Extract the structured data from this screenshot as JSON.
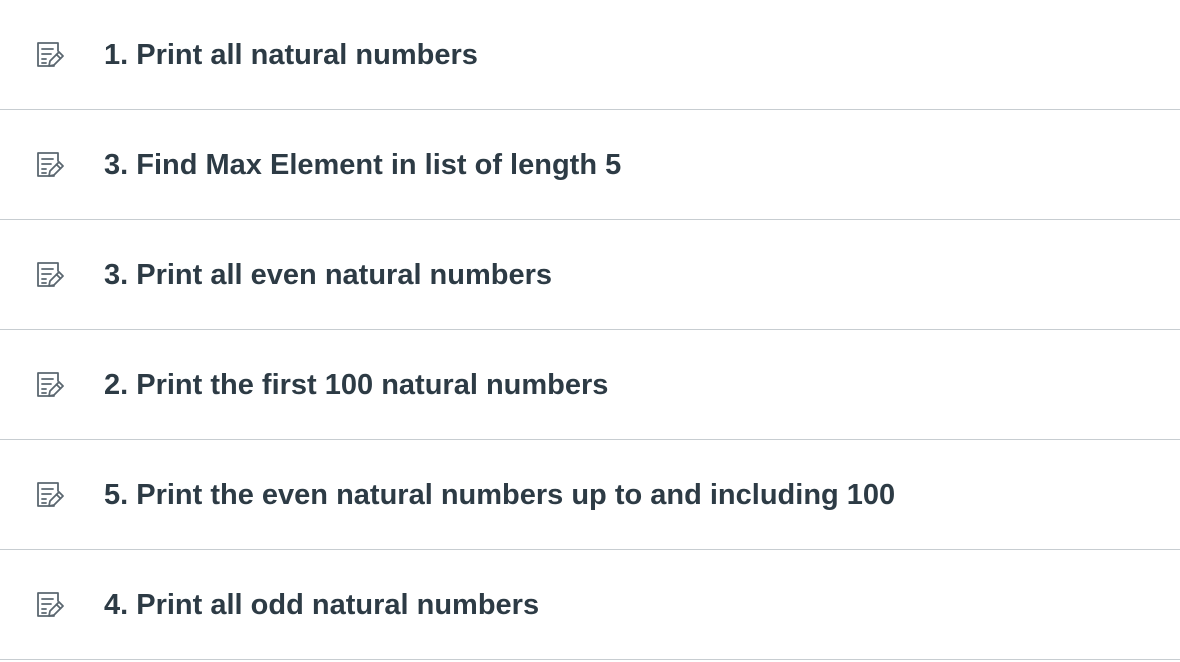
{
  "assignments": {
    "icon": "assignment-edit-icon",
    "items": [
      {
        "title": "1. Print all natural numbers"
      },
      {
        "title": "3. Find Max Element in list of length 5"
      },
      {
        "title": "3. Print all even natural numbers"
      },
      {
        "title": "2. Print the first 100 natural numbers"
      },
      {
        "title": "5. Print the even natural numbers up to and including 100"
      },
      {
        "title": "4. Print all odd natural numbers"
      }
    ]
  },
  "colors": {
    "text": "#2d3b45",
    "icon": "#5b6770",
    "divider": "#c7cdd1"
  }
}
